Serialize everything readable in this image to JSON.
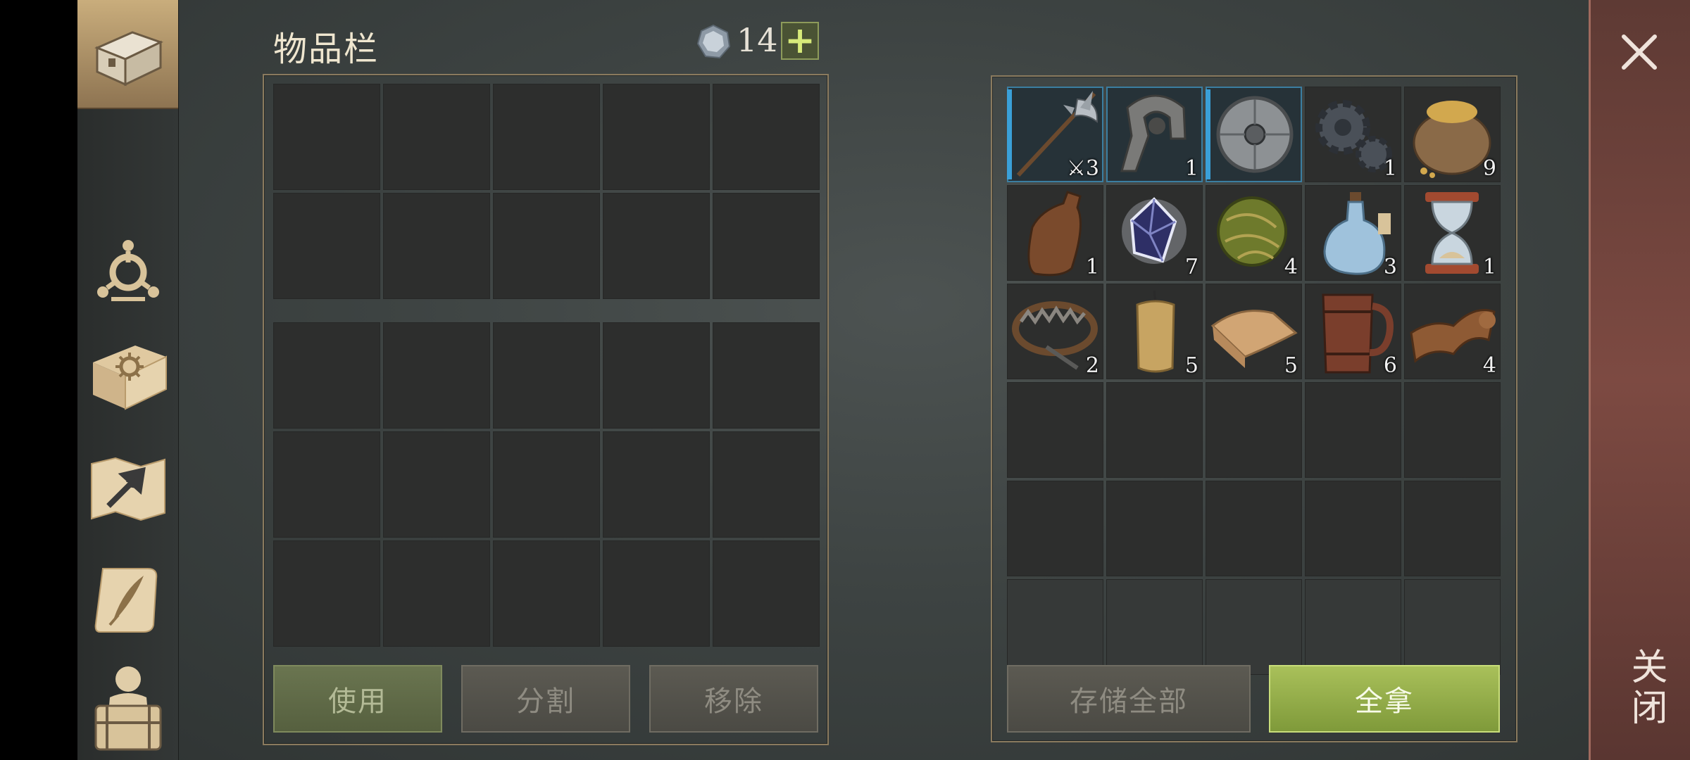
{
  "inventory": {
    "title": "物品栏",
    "currency_count": "14",
    "plus_label": "+"
  },
  "left_buttons": {
    "use": "使用",
    "split": "分割",
    "remove": "移除"
  },
  "right_buttons": {
    "store_all": "存储全部",
    "take_all": "全拿"
  },
  "close": {
    "label": "关闭",
    "icon": "close-icon"
  },
  "sidebar": {
    "tabs": [
      {
        "icon": "chest-icon",
        "active": true
      },
      {
        "icon": "skills-icon"
      },
      {
        "icon": "recipe-book-icon"
      },
      {
        "icon": "map-icon"
      },
      {
        "icon": "quest-scroll-icon"
      },
      {
        "icon": "character-icon"
      }
    ]
  },
  "container_items": [
    {
      "name": "halberd",
      "count": "3",
      "count_prefix": "⚔"
    },
    {
      "name": "iron-clamp",
      "count": "1"
    },
    {
      "name": "round-shield",
      "count": ""
    },
    {
      "name": "gears",
      "count": "1"
    },
    {
      "name": "grain-sack",
      "count": "9"
    },
    {
      "name": "leather-flask",
      "count": "1"
    },
    {
      "name": "crystal",
      "count": "7"
    },
    {
      "name": "herb-ball",
      "count": "4"
    },
    {
      "name": "potion-bottle",
      "count": "3"
    },
    {
      "name": "hourglass",
      "count": "1"
    },
    {
      "name": "bear-trap",
      "count": "2"
    },
    {
      "name": "candle",
      "count": "5"
    },
    {
      "name": "cloth",
      "count": "5"
    },
    {
      "name": "wooden-mug",
      "count": "6"
    },
    {
      "name": "leather-scroll",
      "count": "4"
    }
  ]
}
